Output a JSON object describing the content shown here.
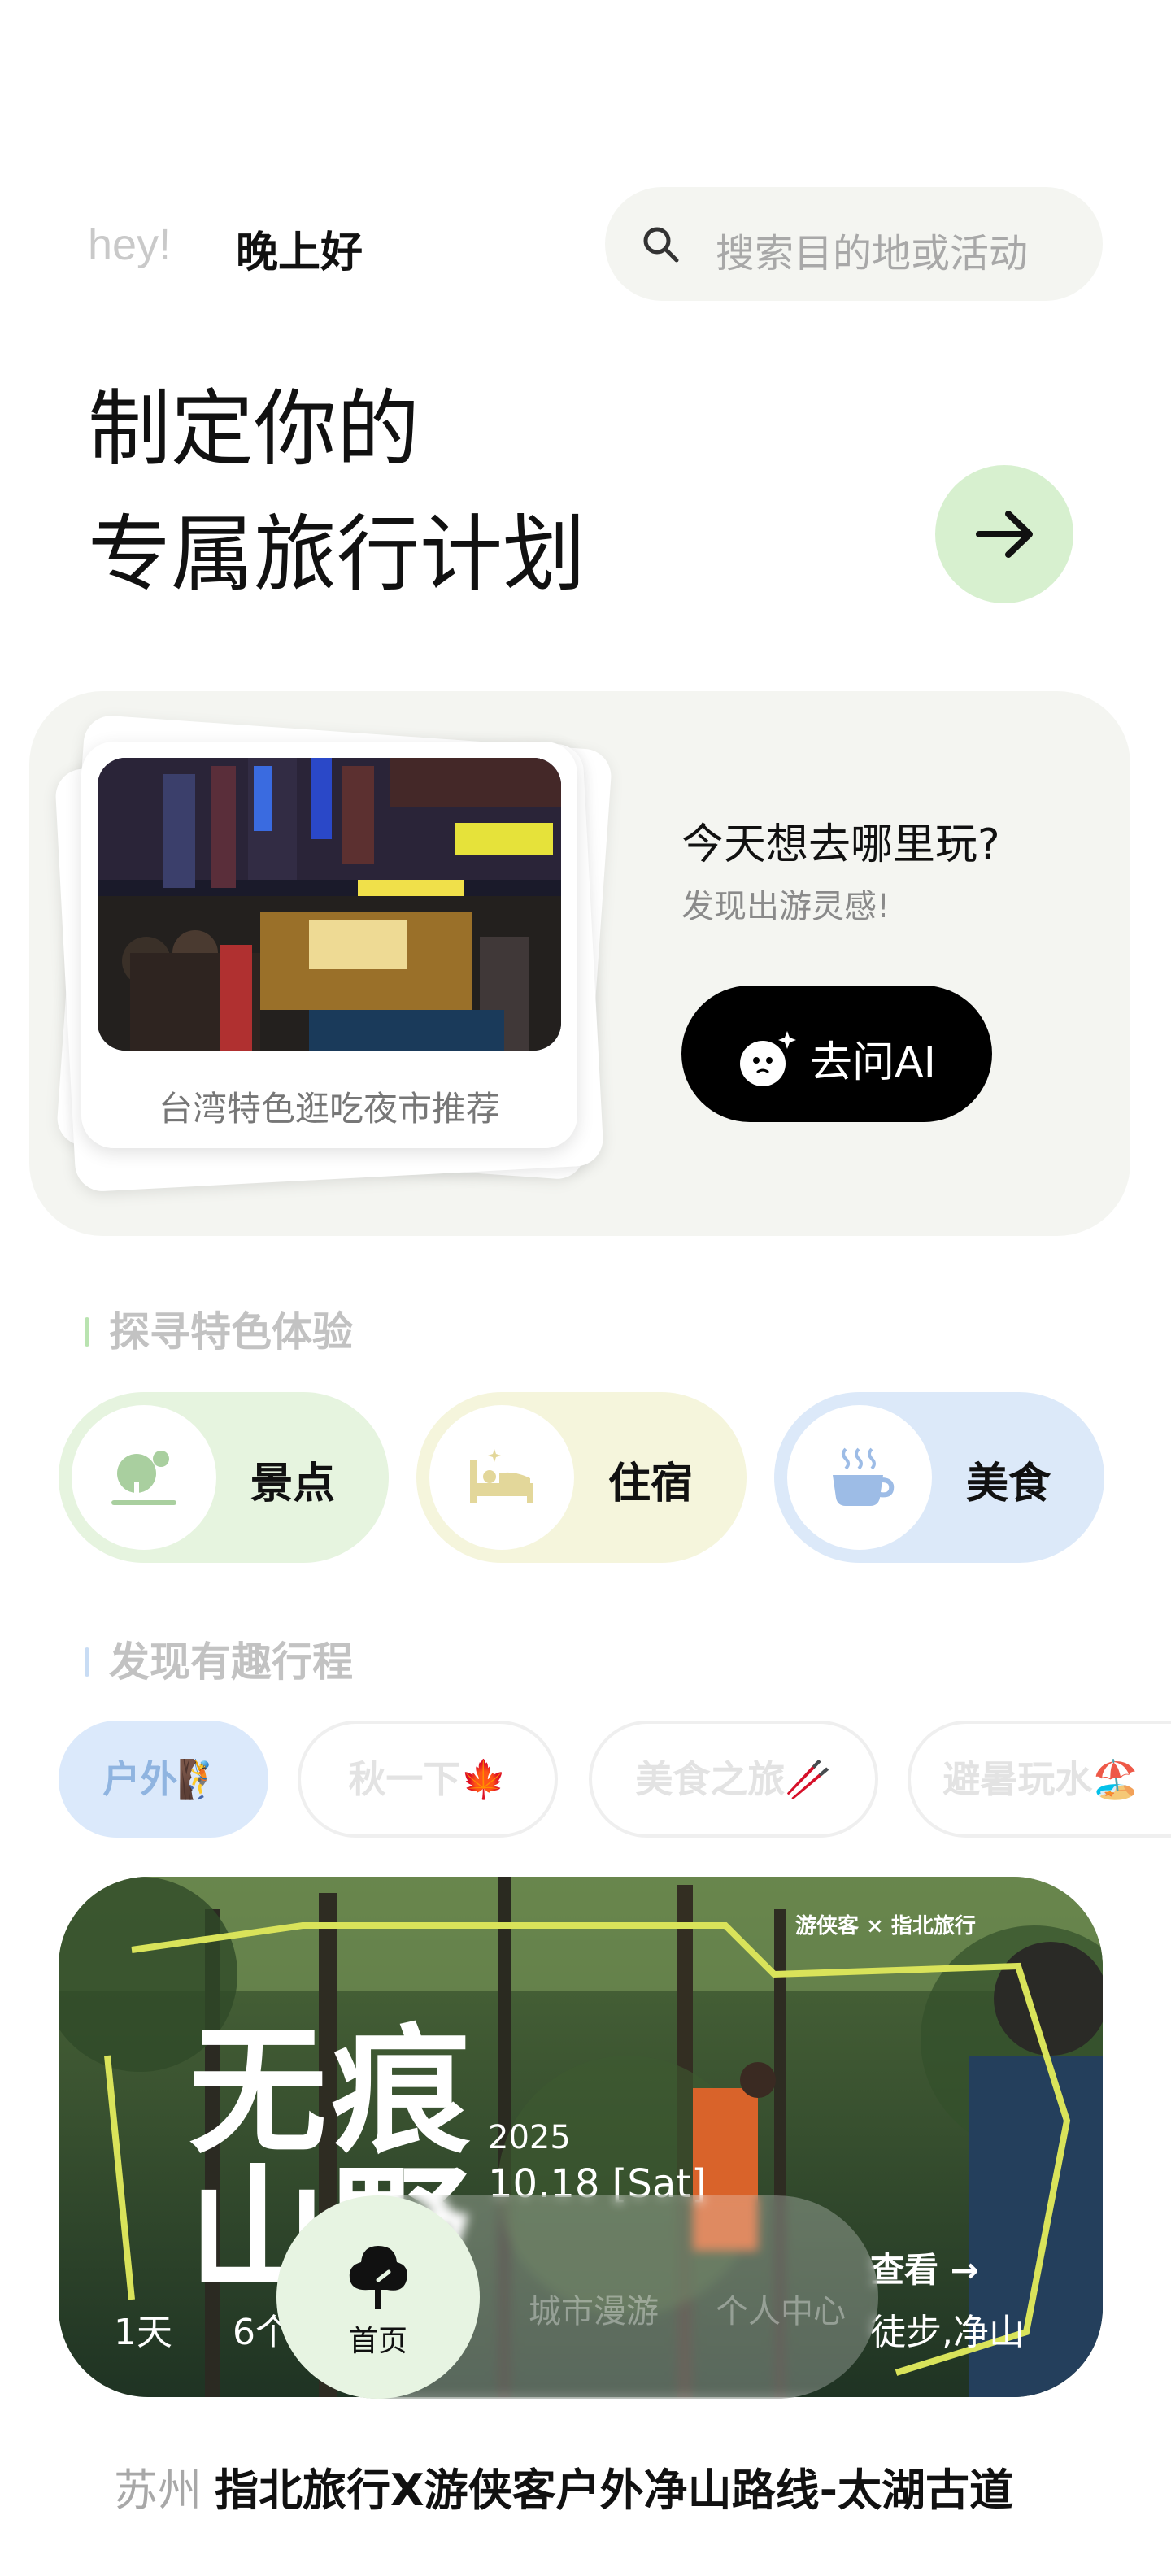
{
  "header": {
    "hey": "hey!",
    "greeting": "晚上好",
    "search_placeholder": "搜索目的地或活动"
  },
  "hero": {
    "line1": "制定你的",
    "line2": "专属旅行计划",
    "go_icon": "arrow-right-icon"
  },
  "ai_card": {
    "photo_caption": "台湾特色逛吃夜市推荐",
    "question": "今天想去哪里玩?",
    "subtitle": "发现出游灵感!",
    "button_label": "去问AI"
  },
  "sections": {
    "experience_title": "探寻特色体验",
    "itinerary_title": "发现有趣行程"
  },
  "categories": [
    {
      "label": "景点",
      "icon": "tree-icon",
      "color": "#e6f4df"
    },
    {
      "label": "住宿",
      "icon": "bed-icon",
      "color": "#f5f5dc"
    },
    {
      "label": "美食",
      "icon": "coffee-icon",
      "color": "#dce9f9"
    }
  ],
  "chips": [
    {
      "label": "户外🧗",
      "active": true
    },
    {
      "label": "秋一下🍁",
      "active": false
    },
    {
      "label": "美食之旅🥢",
      "active": false
    },
    {
      "label": "避暑玩水🏖️",
      "active": false
    }
  ],
  "banner": {
    "brand": "游侠客 × 指北旅行",
    "title_line1": "无痕",
    "title_line2": "山野",
    "year": "2025",
    "date": "10.18 [Sat]",
    "days": "1天",
    "count": "6个",
    "view": "查看 →",
    "tags": "徒步,净山"
  },
  "nav": {
    "home": "首页",
    "city": "城市漫游",
    "profile": "个人中心"
  },
  "featured": {
    "city": "苏州",
    "title": "指北旅行X游侠客户外净山路线-太湖古道"
  }
}
